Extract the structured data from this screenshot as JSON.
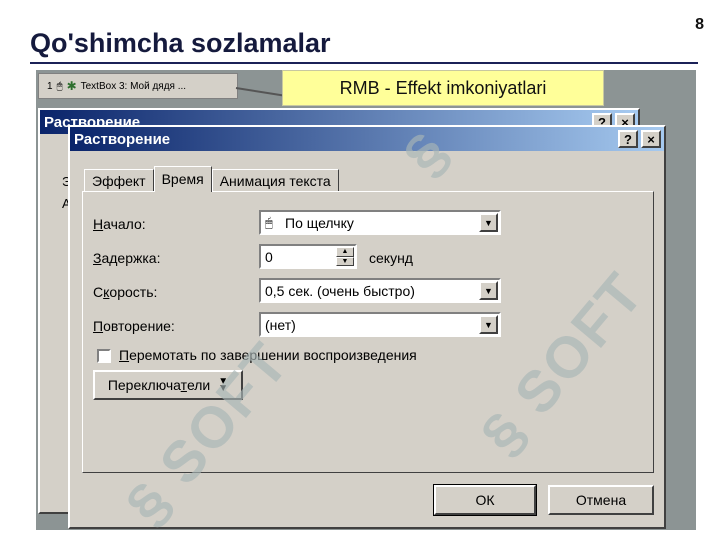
{
  "slide": {
    "number": "8",
    "title": "Qo'shimcha sozlamalar"
  },
  "callout": {
    "text": "RMB - Effekt imkoniyatlari"
  },
  "animation_list": {
    "index": "1",
    "item": "TextBox 3: Мой дядя ..."
  },
  "back_dialog": {
    "title": "Растворение",
    "help": "?",
    "close": "×",
    "frag_top": "Э",
    "frag_mid": "А"
  },
  "dialog": {
    "title": "Растворение",
    "help": "?",
    "close": "×",
    "tabs": [
      {
        "label": "Эффект"
      },
      {
        "label": "Время"
      },
      {
        "label": "Анимация текста"
      }
    ],
    "start": {
      "label_u": "Н",
      "label_rest": "ачало:",
      "value": "По щелчку"
    },
    "delay": {
      "label_u": "З",
      "label_rest": "адержка:",
      "value": "0",
      "unit": "секунд"
    },
    "speed": {
      "label_a": "С",
      "label_u": "к",
      "label_rest": "орость:",
      "value": "0,5 сек. (очень быстро)"
    },
    "repeat": {
      "label_u": "П",
      "label_rest": "овторение:",
      "value": "(нет)"
    },
    "rewind": {
      "label_u": "П",
      "label_rest": "еремотать по завершении воспроизведения",
      "checked": false
    },
    "triggers": {
      "label_a": "Переключа",
      "label_u": "т",
      "label_rest": "ели"
    },
    "ok": "ОК",
    "cancel": "Отмена"
  },
  "icons": {
    "mouse": "mouse-icon",
    "star": "star-icon",
    "dropdown": "chevron-down-icon",
    "expand": "double-chevron-icon"
  },
  "colors": {
    "titlebar_start": "#0a246a",
    "titlebar_end": "#a6caf0",
    "dialog_face": "#d4d0c8",
    "callout_bg": "#ffff99",
    "title_rule": "#1b2157"
  }
}
